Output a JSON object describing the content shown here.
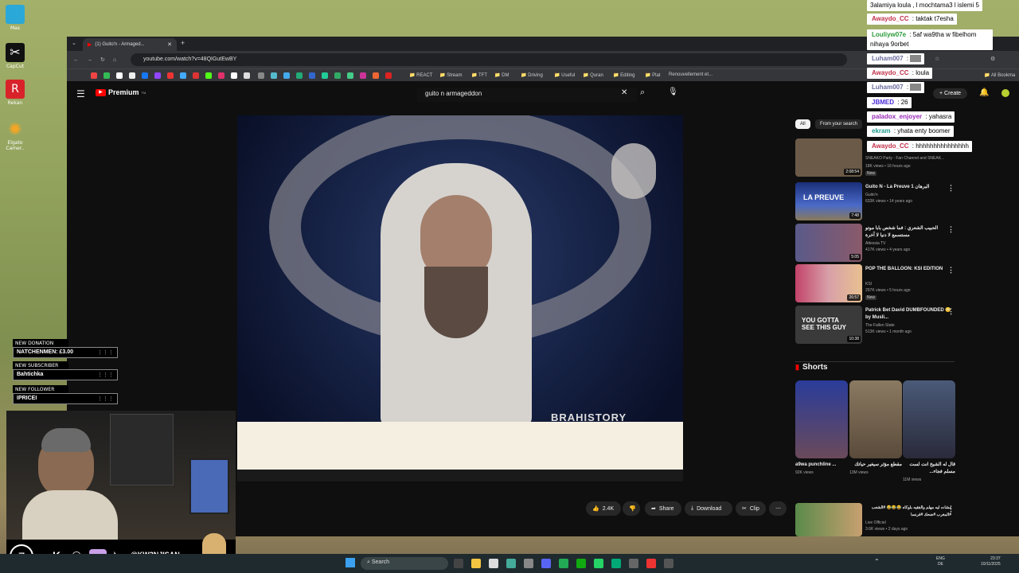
{
  "desktop": {
    "icons": [
      {
        "label": "Mas",
        "icon": "app-icon",
        "color": "#2aa8d8"
      },
      {
        "label": "CapCut",
        "icon": "capcut-icon",
        "color": "#111111"
      },
      {
        "label": "Rekan",
        "icon": "rekan-icon",
        "color": "#d8232a"
      },
      {
        "label": "Elgato Camer..",
        "icon": "camera-hub-icon",
        "color": "#f5a623"
      }
    ]
  },
  "browser": {
    "tab_title": "(1) Guito'n - Armaged...",
    "url": "youtube.com/watch?v=48QIGutEwBY",
    "bookmarks": [
      "REACT",
      "Stream",
      "TFT",
      "DM",
      "Driving",
      "Useful",
      "Quran",
      "Editing",
      "Plat",
      "Renouvellement et...",
      "All Bookma"
    ]
  },
  "youtube": {
    "logo": "Premium",
    "logo_sup": "TM",
    "search_query": "guito n armageddon",
    "create_label": "Create",
    "video_watermark": "BRAHISTORY",
    "actions": {
      "likes": "2.4K",
      "share": "Share",
      "download": "Download",
      "clip": "Clip"
    },
    "filters": [
      "All",
      "From your search"
    ],
    "recommendations": [
      {
        "title": "",
        "channel": "SNEAKO Party - Fan Channel and SNEAK...",
        "meta": "18K views • 16 hours ago",
        "badge": "New",
        "duration": "2:08:54",
        "color": "#6b5a48"
      },
      {
        "title": "Guito N - La Preuve 1 البرهان",
        "channel": "Guito'n",
        "meta": "633K views • 14 years ago",
        "badge": "",
        "duration": "7:48",
        "color": "#2a3e8a",
        "thumb_text": "LA PREUVE"
      },
      {
        "title": "الحبيب الشعري : فما شخص بابا موتو مستسمع لا دنيا لا آخرة",
        "channel": "Attessia TV",
        "meta": "417K views • 4 years ago",
        "badge": "",
        "duration": "5:05",
        "color": "#5a5a8a"
      },
      {
        "title": "POP THE BALLOON: KSI EDITION",
        "channel": "KSI",
        "meta": "297K views • 5 hours ago",
        "badge": "New",
        "duration": "26:57",
        "color": "#c2436a"
      },
      {
        "title": "Patrick Bet David DUMBFOUNDED 😳 by Musli...",
        "channel": "The Fallen State",
        "meta": "513K views • 1 month ago",
        "badge": "",
        "duration": "10:38",
        "color": "#3a3a3a",
        "thumb_text": "YOU GOTTA SEE THIS GUY"
      }
    ],
    "shorts_heading": "Shorts",
    "shorts": [
      {
        "title": "a9wa punchline ...",
        "meta": "92K views",
        "color": "#3a4c8a"
      },
      {
        "title": "مقطع مؤثر سيغير حياتك",
        "meta": "13M views",
        "color": "#7a6a52"
      },
      {
        "title": "قال له الشيخ انت لست مسلم فجاء...",
        "meta": "11M views",
        "color": "#4a5a78"
      }
    ],
    "bottom_rec": {
      "title": "مشات ليه مهلم والفقيه بلوكاه 😂😂😂 #الشعب #المغرب #ضحك #فرنسا",
      "channel": "Live Officiel",
      "meta": "3.6K views • 2 days ago"
    }
  },
  "chat": [
    {
      "user": "",
      "text": "3alamiya loula , l mochtama3 l islemi 5",
      "color": "#000000"
    },
    {
      "user": "Awaydo_CC",
      "text": ": taktak t7esha",
      "color": "#c0304a"
    },
    {
      "user": "Louliyw07e",
      "text": ": 5af wa9tha w fibelhom nihaya 9orbet",
      "color": "#2a9a3a"
    },
    {
      "user": "Luham007",
      "text": ":",
      "color": "#6a6aa0"
    },
    {
      "user": "Awaydo_CC",
      "text": ": loula",
      "color": "#c0304a"
    },
    {
      "user": "Luham007",
      "text": ":",
      "color": "#6a6aa0"
    },
    {
      "user": "JBMED",
      "text": ": 26",
      "color": "#4a2ad8"
    },
    {
      "user": "paladox_enjoyer",
      "text": ": yahasra",
      "color": "#9a2ab8"
    },
    {
      "user": "ekram",
      "text": ": yhata enty boomer",
      "color": "#1a9a8a"
    },
    {
      "user": "Awaydo_CC",
      "text": ": hhhhhhhhhhhhhhh",
      "color": "#c0304a"
    }
  ],
  "alerts": [
    {
      "heading": "NEW DONATION",
      "value": "NATCHENMEN: £3.00"
    },
    {
      "heading": "NEW SUBSCRIBER",
      "value": "Bahtichka"
    },
    {
      "heading": "NEW FOLLOWER",
      "value": "IPRICEI"
    }
  ],
  "socials": {
    "handle": "@KW3NJISAN"
  },
  "taskbar": {
    "search": "Search",
    "lang_top": "ENG",
    "lang_bottom": "DE",
    "time": "23:37",
    "date": "10/11/2025"
  }
}
